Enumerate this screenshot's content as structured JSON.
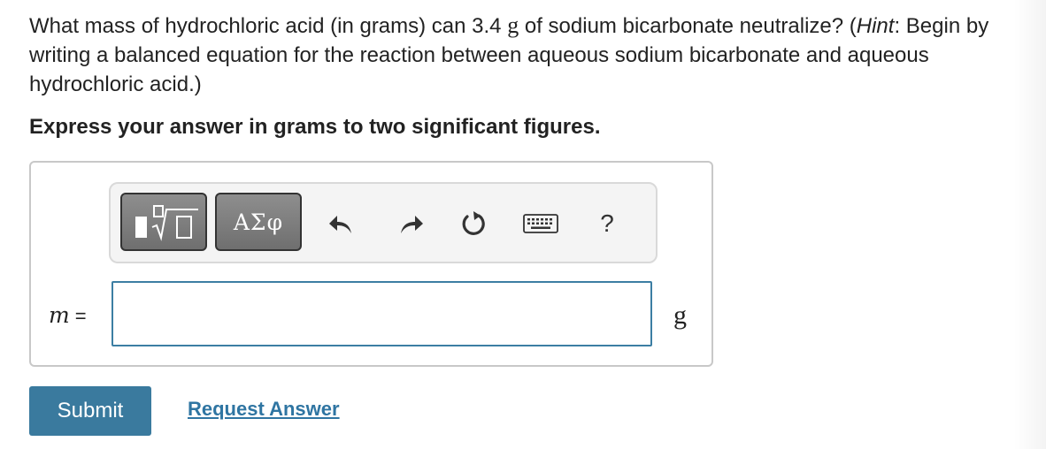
{
  "question": {
    "part1": "What mass of hydrochloric acid (in grams) can 3.4 ",
    "unit_g": "g",
    "part2": " of sodium bicarbonate neutralize? (",
    "hint_label": "Hint",
    "part3": ": Begin by writing a balanced equation for the reaction between aqueous sodium bicarbonate and aqueous hydrochloric acid.)"
  },
  "instruction": "Express your answer in grams to two significant figures.",
  "toolbar": {
    "templates_icon": "templates-radical-icon",
    "greek_label": "ΑΣφ",
    "undo_icon": "undo-icon",
    "redo_icon": "redo-icon",
    "reset_icon": "reset-icon",
    "keyboard_icon": "keyboard-icon",
    "help_label": "?"
  },
  "answer": {
    "variable": "m",
    "equals": "=",
    "value": "",
    "unit": "g"
  },
  "actions": {
    "submit_label": "Submit",
    "request_answer_label": "Request Answer"
  },
  "colors": {
    "submit_bg": "#3a7a9e",
    "link": "#2f75a2",
    "input_border": "#3c7ea3",
    "toolbar_button": "#7f7f7f"
  }
}
